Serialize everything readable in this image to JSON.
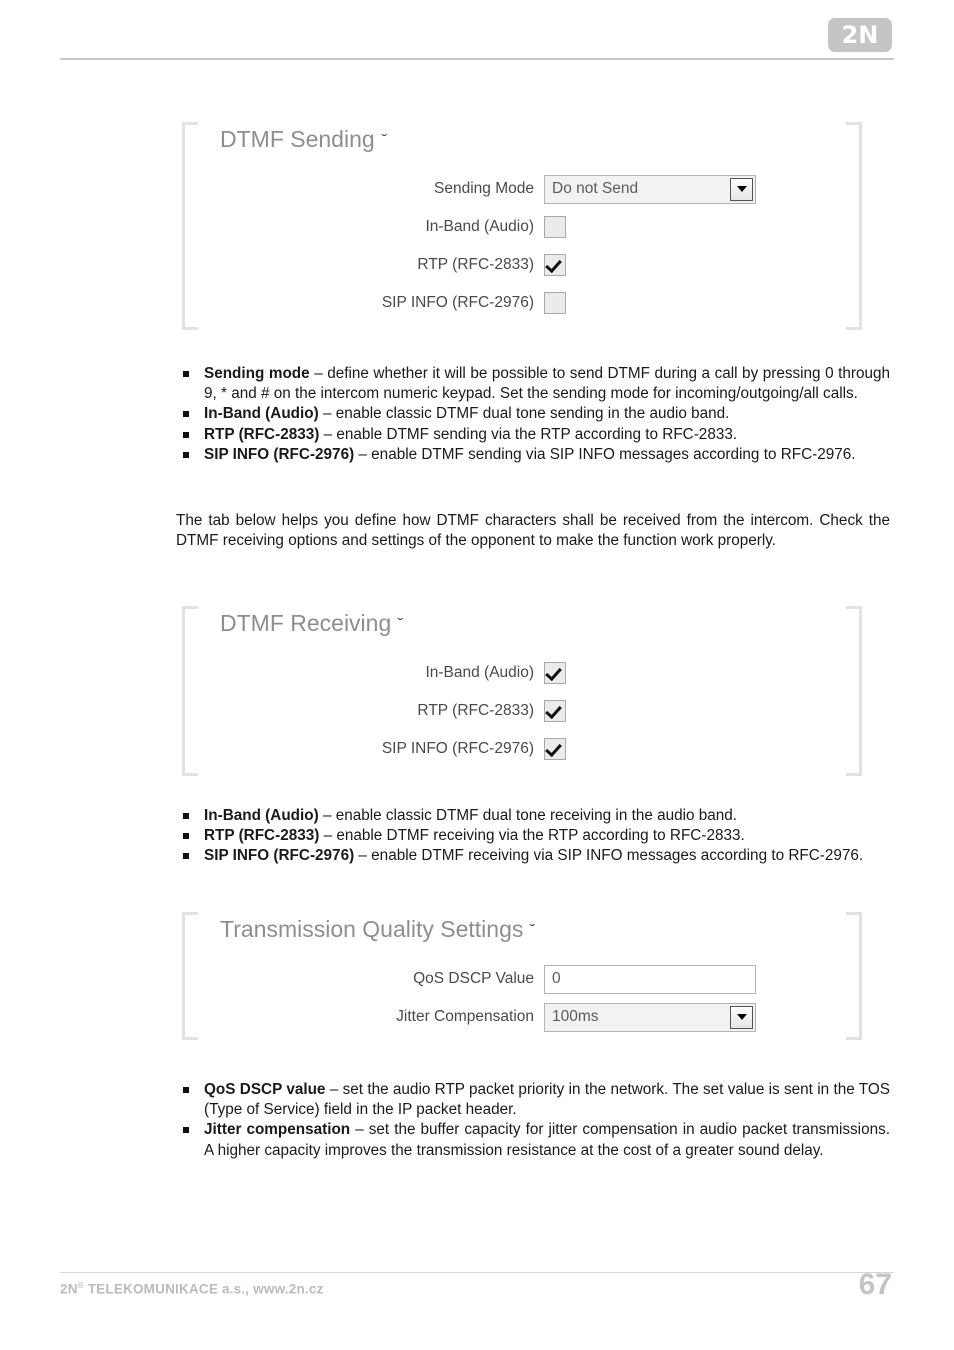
{
  "header": {
    "logo_text": "2N"
  },
  "panels": [
    {
      "title": "DTMF Sending",
      "chevron": "ˇ",
      "rows": [
        {
          "label": "Sending Mode",
          "type": "select",
          "value": "Do not Send"
        },
        {
          "label": "In-Band (Audio)",
          "type": "checkbox",
          "checked": false
        },
        {
          "label": "RTP (RFC-2833)",
          "type": "checkbox",
          "checked": true
        },
        {
          "label": "SIP INFO (RFC-2976)",
          "type": "checkbox",
          "checked": false
        }
      ]
    },
    {
      "title": "DTMF Receiving",
      "chevron": "ˇ",
      "rows": [
        {
          "label": "In-Band (Audio)",
          "type": "checkbox",
          "checked": true
        },
        {
          "label": "RTP (RFC-2833)",
          "type": "checkbox",
          "checked": true
        },
        {
          "label": "SIP INFO (RFC-2976)",
          "type": "checkbox",
          "checked": true
        }
      ]
    },
    {
      "title": "Transmission Quality Settings",
      "chevron": "ˇ",
      "rows": [
        {
          "label": "QoS DSCP Value",
          "type": "input",
          "value": "0"
        },
        {
          "label": "Jitter Compensation",
          "type": "select",
          "value": "100ms"
        }
      ]
    }
  ],
  "sending_bullets": [
    {
      "term": "Sending mode",
      "text": " – define whether it will be possible to send DTMF during a call by pressing 0 through 9, * and # on the intercom numeric keypad. Set the sending mode for incoming/outgoing/all calls."
    },
    {
      "term": "In-Band (Audio)",
      "text": " – enable classic DTMF dual tone sending in the audio band."
    },
    {
      "term": "RTP (RFC-2833)",
      "text": " – enable DTMF sending via the RTP according to RFC-2833."
    },
    {
      "term": "SIP INFO (RFC-2976)",
      "text": " – enable DTMF sending via SIP INFO messages according to RFC-2976."
    }
  ],
  "middle_paragraph": "The tab below helps you define how DTMF characters shall be received from the intercom. Check the DTMF receiving options and settings of the opponent to make the function work properly.",
  "receiving_bullets": [
    {
      "term": "In-Band (Audio)",
      "text": " – enable classic DTMF dual tone receiving in the audio band."
    },
    {
      "term": "RTP (RFC-2833)",
      "text": " – enable DTMF receiving via the RTP according to RFC-2833."
    },
    {
      "term": "SIP INFO (RFC-2976)",
      "text": " – enable DTMF receiving via SIP INFO messages according to RFC-2976."
    }
  ],
  "quality_bullets": [
    {
      "term": "QoS DSCP value",
      "text": " – set the audio RTP packet priority in the network. The set value is sent in the TOS (Type of Service) field in the IP packet header."
    },
    {
      "term": "Jitter compensation",
      "text": " – set the buffer capacity for jitter compensation in audio packet transmissions. A higher capacity improves the transmission resistance at the cost of a greater sound delay."
    }
  ],
  "footer": {
    "company_prefix": "2N",
    "company_sup": "®",
    "company_rest": " TELEKOMUNIKACE a.s., www.2n.cz",
    "page_number": "67"
  }
}
